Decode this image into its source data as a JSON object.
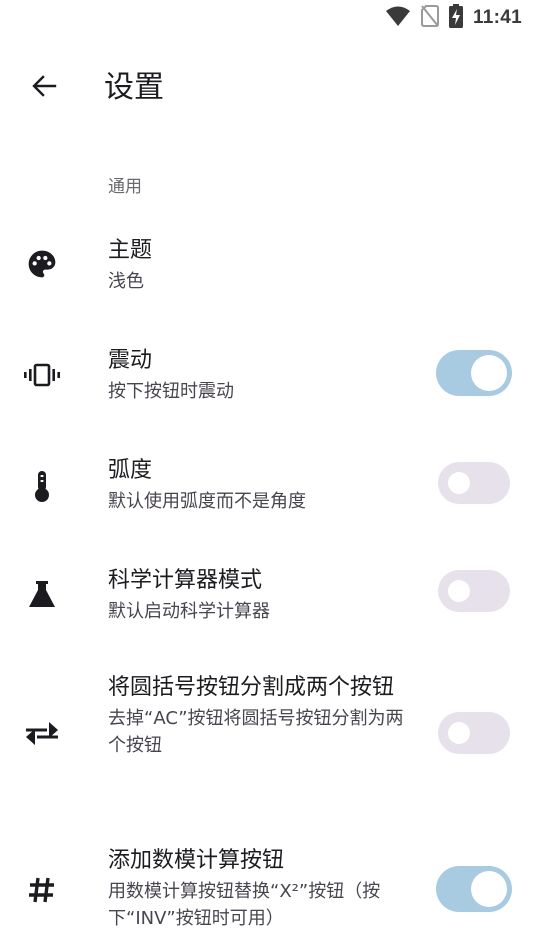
{
  "status_bar": {
    "time": "11:41",
    "icons": [
      "wifi-icon",
      "no-sim-icon",
      "battery-charging-icon"
    ]
  },
  "app_bar": {
    "back_icon": "arrow-back-icon",
    "title": "设置"
  },
  "section": {
    "header": "通用"
  },
  "settings": [
    {
      "key": "theme",
      "icon": "palette-icon",
      "title": "主题",
      "summary": "浅色"
    },
    {
      "key": "vibration",
      "icon": "vibration-icon",
      "title": "震动",
      "summary": "按下按钮时震动",
      "switch": true
    },
    {
      "key": "radians",
      "icon": "thermometer-icon",
      "title": "弧度",
      "summary": "默认使用弧度而不是角度",
      "switch": false
    },
    {
      "key": "scientific_mode",
      "icon": "flask-icon",
      "title": "科学计算器模式",
      "summary": "默认启动科学计算器",
      "switch": false
    },
    {
      "key": "split_parentheses",
      "icon": "swap-horiz-icon",
      "title": "将圆括号按钮分割成两个按钮",
      "summary": "去掉“AC”按钮将圆括号按钮分割为两个按钮",
      "switch": false
    },
    {
      "key": "modulo_button",
      "icon": "hashtag-icon",
      "title": "添加数模计算按钮",
      "summary": "用数模计算按钮替换“X²”按钮（按下“INV”按钮时可用）",
      "switch": true
    }
  ],
  "colors": {
    "switch_on_track": "#a8cbe2",
    "switch_off_track": "#e6e1ea",
    "text_primary": "#1c1b1f",
    "text_secondary": "#49454f"
  }
}
